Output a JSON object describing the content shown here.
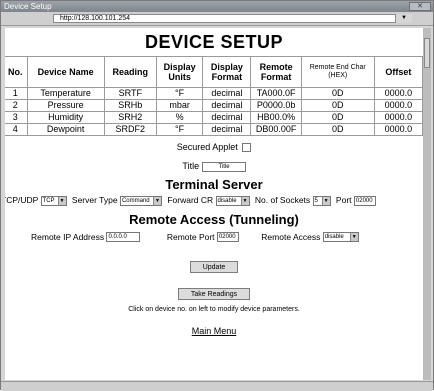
{
  "window": {
    "title": "Device Setup"
  },
  "address": {
    "url": "http://128.100.101.254"
  },
  "page": {
    "title": "DEVICE SETUP"
  },
  "table": {
    "headers": [
      "No.",
      "Device Name",
      "Reading",
      "Display Units",
      "Display Format",
      "Remote Format",
      "Remote End Char (HEX)",
      "Offset"
    ],
    "rows": [
      [
        "1",
        "Temperature",
        "SRTF",
        "°F",
        "decimal",
        "TA000.0F",
        "0D",
        "0000.0"
      ],
      [
        "2",
        "Pressure",
        "SRHb",
        "mbar",
        "decimal",
        "P0000.0b",
        "0D",
        "0000.0"
      ],
      [
        "3",
        "Humidity",
        "SRH2",
        "%",
        "decimal",
        "HB00.0%",
        "0D",
        "0000.0"
      ],
      [
        "4",
        "Dewpoint",
        "SRDF2",
        "°F",
        "decimal",
        "DB00.00F",
        "0D",
        "0000.0"
      ]
    ]
  },
  "secured": {
    "label": "Secured Applet"
  },
  "title_field": {
    "label": "Title",
    "value": "Title"
  },
  "terminal": {
    "heading": "Terminal Server",
    "tcpudp_label": "TCP/UDP",
    "tcpudp_value": "TCP",
    "server_type_label": "Server Type",
    "server_type_value": "Command",
    "forward_label": "Forward CR",
    "forward_value": "disable",
    "sockets_label": "No. of Sockets",
    "sockets_value": "5",
    "port_label": "Port",
    "port_value": "02000"
  },
  "remote": {
    "heading": "Remote Access (Tunneling)",
    "ip_label": "Remote IP Address",
    "ip_value": "0.0.0.0",
    "port_label": "Remote Port",
    "port_value": "02000",
    "access_label": "Remote Access",
    "access_value": "disable"
  },
  "buttons": {
    "update": "Update",
    "take_readings": "Take Readings"
  },
  "hint": "Click on device no. on left to modify device parameters.",
  "main_menu": "Main Menu"
}
